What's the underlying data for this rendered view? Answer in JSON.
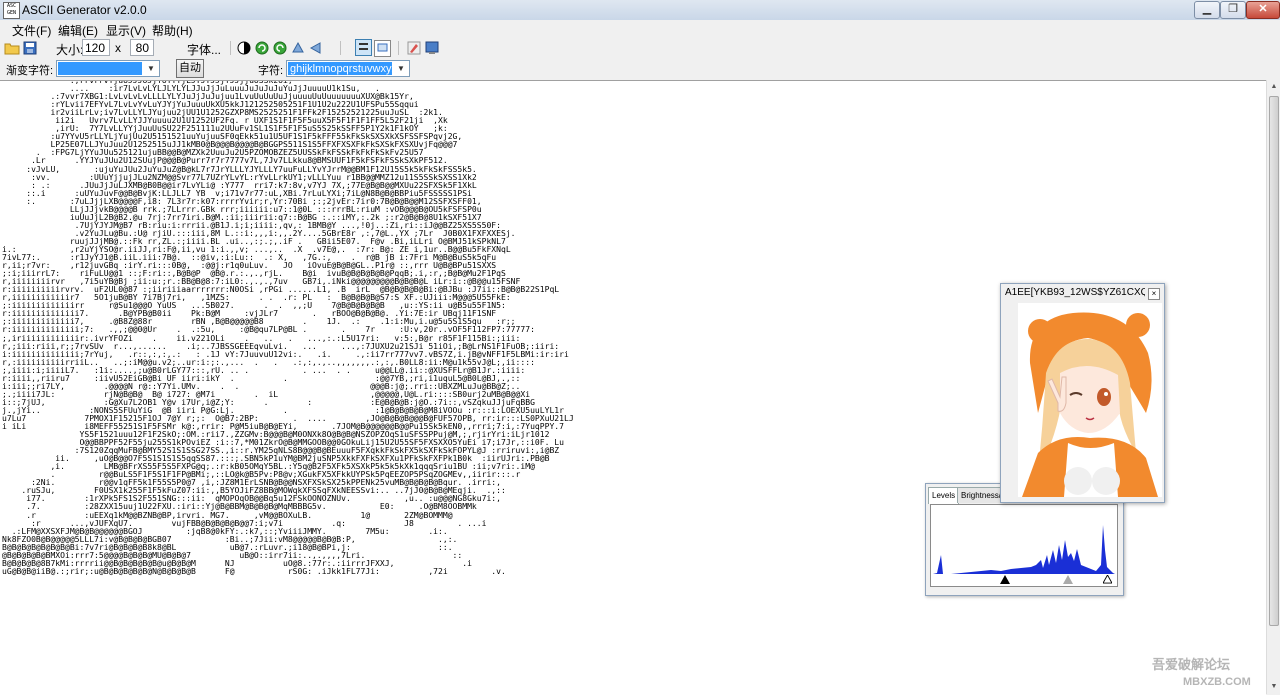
{
  "window": {
    "title": "ASCII Generator v2.0.0",
    "icon_text": "ASC\nGEN"
  },
  "menu": [
    "文件(F)",
    "编辑(E)",
    "显示(V)",
    "帮助(H)"
  ],
  "toolbar": {
    "size_label": "大小:",
    "width": "120",
    "times": "x",
    "height": "80",
    "font_label": "字体..."
  },
  "settings": {
    "ramp_label": "渐变字符:",
    "ramp_value": "",
    "auto_button": "自动",
    "chars_label": "字符:",
    "chars_value": "ghijklmnopqrstuvwxyz$"
  },
  "preview": {
    "title": "A1EE[YKB93_12WS$YZ61CXQ..."
  },
  "levels": {
    "tab_levels": "Levels",
    "tab_brightness": "Brightness/"
  },
  "watermark": {
    "line1": "吾爱破解论坛",
    "line2": "MBXZB.COM"
  },
  "ascii_art": [
    "              .,rrvrrvYjuUJJJUJjYUYYYjLJYJYJJjYJJjjuUSSkzUi,",
    "              ....    :ir7LvLvLYLJLYLYLJJuJjJuLuuuJuJuJuJuYuJjJuuuuU1k1Su,   .",
    "          .:7vvr7XBG1:LvLvLvLvLLLLYLYJuJjJuJujuu1LvuUuUuUuJjuuuuUuUuuuuuuuXUX@Bk15Yr,",
    "          :rYLvii7EFYvL7LvLvYvLuYJYjYuJuuuUkXU5kkJ121252505251F1U1U2u222U1UFSPu55Sqqui",
    "          ir2viiLrLv;iv7LvLLYLJYujuu2jUU1U1252GZXP8MS2525251F1FFk2F15252521225uuJuSL  :2k1.",
    "           ii2i   Uvrv7LvLLYJJYuuuu2U1U1252UF2Fq. r UXF1S1F1F5F5uuX5F5F1F1F1FF5L52F21ji  ,Xk",
    "           ,irU:  7Y7LvLLYYjJuuUuSU22F251111u2UUuFv1SL1S1F5F1F5uS5S25kSSFF5P1Y2k1F1kOY   ;k:",
    "          :u7YYvU5rLLYLjYujUu2U5151521uuYujuuSF0qEkk51u1U5UF1S1F5kFFF55kFkSkSXSXkXSFSSFSPqvj2G,",
    "          LP25E07LLJYuJuu2U1252515uJJ1kMB0@B@@@B@@@@B@BGGPS511S1S5FFXFXSXFkFkSXSkFXSXUvjFq@@@7",
    "       .  :FPG7LjYYuJUu525121ujuBB@@B@MZXk2UuuJu2U5PZOMOBZEZ5UUSSkFkFSSkFkFkFkSkFv25U57",
    "      .Lr      .YYJYuJUu2U12SUujP@@@B@Purr7r7r7777v7L,7Jv7LLkku8@BMSUUF1F5kFSFkFSSkSXkPF512.",
    "     :vJvLU,       :ujuYuJUu2JuYuJuZ@B@kL7r7JrYLLLYJYLLLY7uuFuLLYvYJrrM@@BM1F12U15S5k5kFkSkFSS5k5.",
    "      :vv.        :UUuYjjujJLu2NZM@@Svr77L7UZrYLvYL:rYvLLrkUY1;vLLLYuu r1BB@@MMZ12u11S5SSkSXSS1Xk2",
    "      : .:      .JUuJjJuLJXMB@B0B@@ir7LvYLi@ :Y777  rri7:k7:8v,v7YJ 7X,;77E@B@B@@MXUu22SFXSk5F1XkL",
    "     ::.i      :uUYuJuvF@@B@BvjK:LLJLL7 YB  v;i71v7r77:uL,XBi.7rLuLYXi;7iL@N8B@B@BBPiu5FSSSSS1PSi",
    "     :.       :7uLJjjLXB@@@@F,i8: 7L3r7r:k07:rrrrYvir;r,Yr:70Bi ;:;2jvEr:7ir0:7B@B@B@@M12SSFXSFF01,",
    "              LLjJJjvkB@@@@B rrk.;7LLrrr.GBk rrr;iiiiii:u7::1@0L :::rrrBL:riuM :vOB@@@B@OU5kFSFSP0u",
    "              iuUuJjL2B@B2.@u 7rj:7rr7iri.B@M.:ii;iiirii:q7::B@BG :.::iMY,:.2k ;:r2@B@B@8U1kSXF51X7",
    "               .7UjYJYJM@B7 rB:riu:i:rrrii.@B1J.i;i;iiii:,qv,: 1BMB@Y ...,!0j..:Zi,ri::iJ@@BZ25XS5S50F:",
    "               .v2YuJLu@Bu.:U@ rjiU.:::iii,8M L.::i:,,,i:,,.2Y....5GBrE8r ,:,7@L.,YX ;7Lr  J0B0X1FXFXXESj.",
    "              ruujJJjMB@.::Fk rr,ZL.:;iiii.BL .ui..,:;.;,.iF .   GBii5E07.  F@v .Bi,iLLri O@BMJ51kSPkNL7",
    "i.:           ,r2uYjYSO@r.iiJJ,ri:F@,ii,vu 1:i.,,v; ...,..  .X  .v7E@,.  :7r: B@: ZE i,1ur..B@@Bu5FkFXNqL",
    "7ivL77:.      :r1JyYJ1@B.iiL.iii:7B@.  ::@iv,:i:Lu::  .: X,   ,7G.:,    .  r@B jB i:7Fri M@B@BuS5k5qFu",
    "r,ii;r7vr:    ,r12juvGBq :irY.ri:::0B@,  :@@j:r1q0uLuv.   JO   iOvuE@B@B@GL..P1r@ ::,rrr U@B@BPu51SXXS",
    ";:i;iiirrL7:    riFuLU@@1 ::;F:ri::,B@B@P  @B@.r.:.,.,rjL.    B@i  ivuB@B@B@B@B@PqqB;.i,:r,;B@B@Mu2F1PqS",
    "r,iiiiiiiirvr   ,7i5uYB@Bj ;ii:u:;r.:BB@B@8:7:iL0:.,.,.,7uv   GB7i,.iNki@@@@@@@@@B@B@B@L iLr:i::@B@@u15FSNF",
    "r:iiiiiiiiiirvrv.  uF2UL0@87 :;iiriiiaarrrrrrr:N0OSi ,rPGi ......L1, .B  irL  @B@B@B@B@Bi:@BJBu :J7ii::B@B@B22S1PqL",
    "r,iiiiiiiiiiiir7   5O1juB@BY 7i7Bj7ri,   ,1MZS:      . .  .r: PL   :  B@B@B@B@S7:S XF.:UJiii:M@@@5U55FkE:",
    ";:iiiiiiiiiiiiirr     r@Su1@@@O YuUS   ...5B027.      .  .  ,,;U    7@B@B@B@B@B   ,u::YS:ii u@B5u55F1N5:",
    "r:iiiiiiiiiiiiii7.      .B@YPB@B0ii    Pk:B@M     :vjJLr7       .   rBOO@B@B@B@. .Yi:7E:ir UBqj11F1SNF",
    ";:iiiiiiiiiiiii7,     .@B8Z@88r        rBN ,B@B@@@@@B8        .    1J.  .:    .1:i:Mu,i.u@5u5S1S5qu   :r;;",
    "r:iiiiiiiiiiiiii;7:   .,,;@@0@Ur    .  .:5u,     :@B@qu7LP@BL .       .    7r     :U:v,20r..vOF5F112FP7:77777:",
    ";,iriiiiiiiiiiiir:.ivrYFOZi    .    ii.v221OLi    .   ..   .   ...,:.:L5U17ri:   v:5:,B@r r85F1F115Bi:;iii:",
    "r,;iii:riii,r;;7rvSUv  r...,......    .i;..7JBSSGEEEqvuLvi.   ...     ...,:7JUXU2u21SJi 51iOi,;B@LrNS1F1FuOB;:iiri:",
    "i:iiiiiiiiiiiiii;7rYuj,   .r::,:,:,.:   : .1J vY:7JuuvuU12vi:.   .i.     .,:ii7rr777vv7.vBS7Z,i.jB@vNFF1F5LBMi:ir:iri",
    "r,:iiiiiiiiiirriiL..   ..;:iM@@u.v2;..ur:i:;:.,...  .   .   .:,:,.,..,,,,,,,.:,:,.B0LL8:ii:M@u1k55vJ@L;,ii::::",
    ";,iiii:i;iiiiL7.   :1i:....,;u@B0rLGY77:::,rU. .. .           . ...  . .     u@@LL@.ii::@XUSFFLr@B1Jr.:iiii:",
    "r:iiii,,riiru7     :iivU52EiGB@Bi UF iiri:ikY  .          .                  :@@7YB,;ri,i1uquL5@B0L@BJ,.,::",
    "i:iii;;ri7LY,        .@@@@N r@::Y7Yi.UMv.    .  .                           @@@B:j@;.rri::UBXZMLuJu@BB@Z;..",
    ";.;iiii7JL:          rjN@B@B@  B@ i727: @M7i        .  iL                   ,@@@@@,U@L.ri::::SB0urj2uMB@B@@Xi",
    "i::;7jUJ,            :G@Xu7L2OB1 Y@v i7Ur,i@Z;Y:      .        :            :E@B@B@B:j@O.:7i::,vSZqkuJJjuFqBBG",
    "j.,jYi..          :NONS5SFUuYiG  @B iiri P@G:Lj.          .                  :1@B@B@B@B@M8iVOOu :r:::i:LOEXU5uuLYL1r",
    "u7Lu7            7PMOX1F15215F1OJ 7@Y r;;:  O@B7:2BP:       .  ....        ,JO@B@B@B@@@B@FUF57OPB, rr:ir:::LS0PXuU21LJ",
    "i iLi            i8MEFF55251S1F5FSMr k@:,rrir: P@M5iuB@B@EYi,       .7JOM@B@@@@@@B@@Pu15Sk5kEN0,,rrri;7:i,:7YuqPPY.7",
    "                YS5F1521uuu12F1F2SkO;:OM.:rii7.,ZZGMv:B@@@B@M0ONXk8O@B@B@NSZOPZOqS1uSFS5PPuj@M,;,rjirYri:iLjr1012",
    "                O@@BBPPF52F55ju255S1kPOviEZ :i::7,*M01ZkrO@B@MMGOOB@@0GOkuLij15U2U55SF5FXSXXO5YuEi i7;i7Jr,::i0F. Lu",
    "               :7S120ZqqMuFB@BMY52S1S1SSG27SS.,i::r.YM25qNLS8B@@@B@BEuuuF5FXqkkFkSkFX5kSXFkSkFOPYL@J :rriruvi:,i@BZ",
    "           ii.     ,uO@B@@O7F5S1S1S1S5qqSS87.:::;.SBN5kP1uYM@BM2juSNP5XkkFXFkSXFXu1PFkSkFXFPk1B0k  :iirUJri:.PB@B",
    "          ,i.        LMB@BFrXS55F5S5FXPG@q;.:r:kB05OMqY5BL.:Y5q@B2F5XFk5XSXkP5k5k5kXk1qqqSriu1BU :ii;v7ri:.iM@",
    "          .         r@@BuLS5F1F5S1F1FP@BMi;,::LO@k@B5Pv:P8@v;XGukFX5XFkkUYPSk5PqEEZOP5PSqZOGMEv,,iirir:::.r",
    "      :2Ni.         r@@v1qFF5k1F55S5P0@7 ,i,:JZ8M1ErLSNB@B@@NSXFXSkSX25kPPENk25vuMB@B@B@B@Bqur. .irri:,",
    "    .ruSJu,        F0USX1k255F1F5kFuZ07:ii:,,B5YOJiFZ8BB@MOWqkXFSSqFXkNEESSvi:.. ..7jJ0@B@B@MEqji.  .,::",
    "     i77.        :1rXPk5FS1S2F551SNG:::ii:  qMOPOqOB@@Bq5u12FSkOONOZNUv.           ,u.. :u@@@NG8Gku7i:,",
    "     .7.         :28ZXX15uuj1U22FXU.:iri::Yj@B@BBM@B@B@B@MqMBBBG5v.           E0:     .O@BM8OOBMMk",
    "     .r          :uEEXq1kM@@BZNB@BP,irvri. MG7.     ,vM@@BOXuLB.          1@       2ZM@BOMMM@",
    "      :r      ...,vJUFXqU7.        vujFBB@B@B@B@B@@7:i;v7i          .q:            J8         . ...i",
    "  .:LFM@XXSXFJM@B@B@@@@@@BGOJ         :jqB8@0kFY:.:k7,::;YviiiJMMY.        7M5u:        .i:.",
    "Nk8FZO0B@B@@@@@5LLL7i:v@B@B@B@BGB07           :Bi..;7Jii:vM8@@@@@B@B@B:P,                 .,:.",
    "B@B@B@B@B@B@B@Bi:7v7ri@B@B@B@B8k8@BL           uB@7.:rLuvr.;i18@B@BPi,j:                  ::.",
    "@B@B@B@B@BMXOi:rrr7:5@@@@B@B@B@MU@B@B@7          uB@O::irr7ii:..,.,,,,7Lri.                  ::",
    "B@B@B@B@8B7kMi:rrrrii@@B@B@B@B@B@u@B@B@M      NJ          uO@8.:77r:.:iirrrJFXXJ,              .i",
    "uG@B@B@iiB@.:;rir;:u@B@B@B@B@B@N@B@B@B@B      F@           rS0G: .iJkk1FL77Ji:          ,72i         .v."
  ]
}
